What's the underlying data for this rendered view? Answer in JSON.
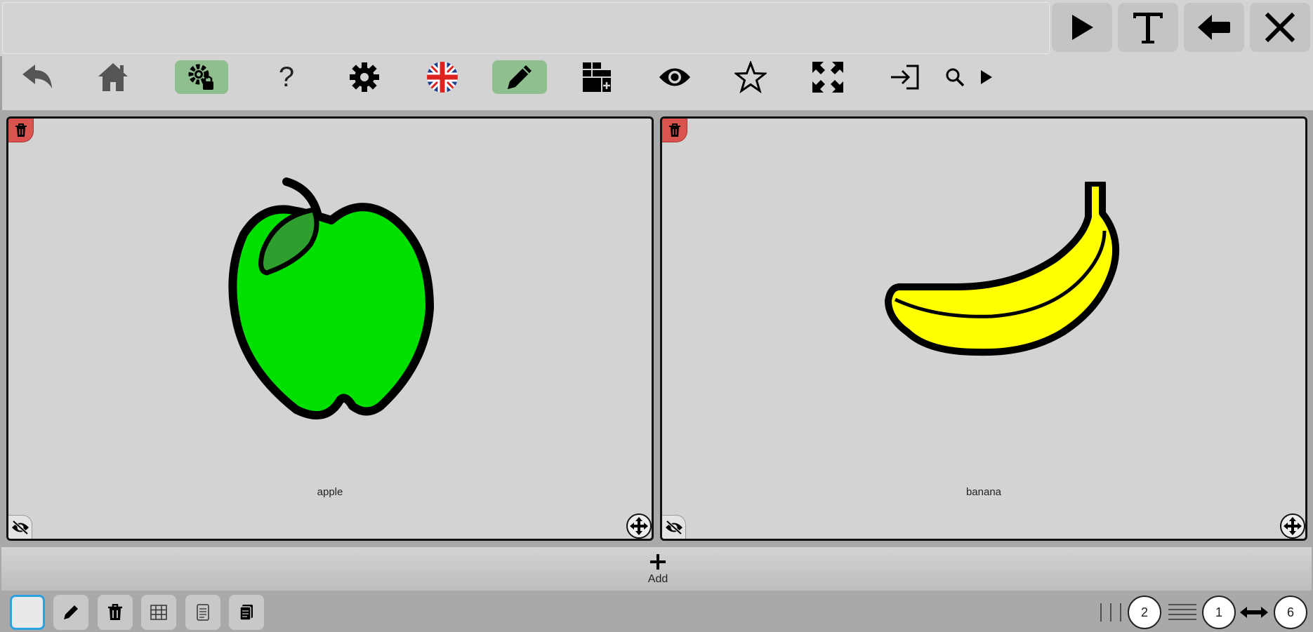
{
  "topbar": {
    "text_display": "",
    "buttons": [
      {
        "name": "play-button",
        "icon": "play-icon"
      },
      {
        "name": "text-button",
        "icon": "text-T-icon"
      },
      {
        "name": "backspace-button",
        "icon": "backspace-arrow-icon"
      },
      {
        "name": "clear-button",
        "icon": "close-icon"
      }
    ]
  },
  "toolbar": {
    "items": [
      {
        "name": "back",
        "icon": "undo-arrow-icon"
      },
      {
        "name": "home",
        "icon": "home-icon"
      },
      {
        "name": "lock-settings",
        "icon": "gear-lock-icon",
        "active": true
      },
      {
        "name": "help",
        "icon": "question-icon",
        "label": "?"
      },
      {
        "name": "settings",
        "icon": "gear-icon"
      },
      {
        "name": "language",
        "icon": "uk-flag-icon"
      },
      {
        "name": "edit",
        "icon": "pencil-icon",
        "active": true
      },
      {
        "name": "add-grid",
        "icon": "grid-plus-icon"
      },
      {
        "name": "view",
        "icon": "eye-icon"
      },
      {
        "name": "favorite",
        "icon": "star-icon"
      },
      {
        "name": "fullscreen",
        "icon": "expand-icon"
      },
      {
        "name": "login",
        "icon": "sign-in-icon"
      },
      {
        "name": "search",
        "icon": "search-icon"
      },
      {
        "name": "more",
        "icon": "triangle-right-icon"
      }
    ]
  },
  "cells": [
    {
      "label": "apple",
      "image": "apple-icon"
    },
    {
      "label": "banana",
      "image": "banana-icon"
    }
  ],
  "addbar": {
    "label": "Add"
  },
  "bottombar": {
    "tools": [
      "color-swatch",
      "pencil-icon",
      "trash-icon",
      "grid-icon",
      "page-icon",
      "pages-icon"
    ],
    "columns": "2",
    "rows": "1",
    "width": "6"
  },
  "colors": {
    "background": "#a9a9a9",
    "panel": "#d3d3d3",
    "active_green": "#8fbf8f",
    "delete_red": "#d9534f",
    "apple_green": "#00e000",
    "banana_yellow": "#ffff00",
    "selected_blue": "#2aa3e0"
  }
}
